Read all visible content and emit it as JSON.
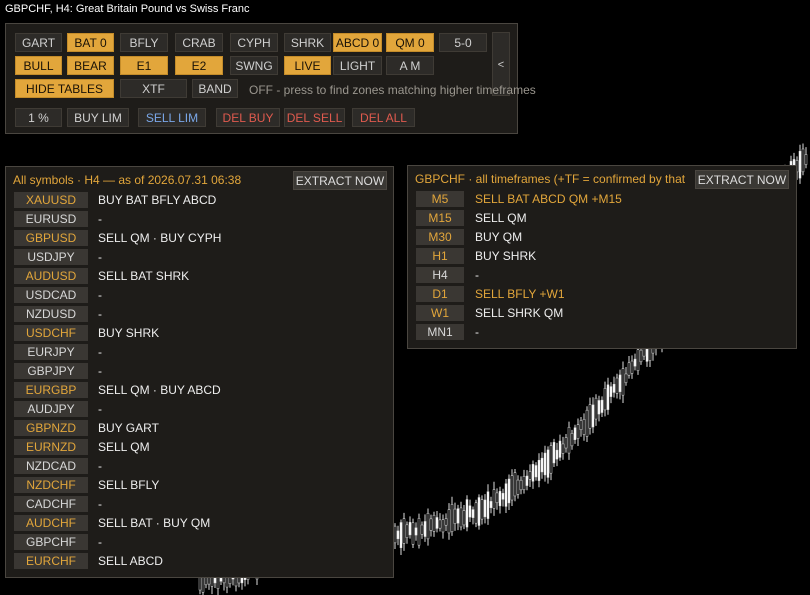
{
  "window": {
    "title": "GBPCHF, H4:  Great Britain Pound vs Swiss Franc"
  },
  "colors": {
    "accent": "#e2a63b",
    "button": "#2d2b28",
    "panel": "#1e1c19",
    "buy_lim": "#7aa7e8",
    "delete": "#e05a4e"
  },
  "toolbar": {
    "buttons": [
      {
        "label": "GART",
        "active": false
      },
      {
        "label": "BAT 0",
        "active": true
      },
      {
        "label": "BFLY",
        "active": false
      },
      {
        "label": "CRAB",
        "active": false
      },
      {
        "label": "CYPH",
        "active": false
      },
      {
        "label": "SHRK",
        "active": false
      },
      {
        "label": "ABCD 0",
        "active": true
      },
      {
        "label": "QM 0",
        "active": true
      },
      {
        "label": "5-0",
        "active": false
      },
      {
        "label": "BULL",
        "active": true
      },
      {
        "label": "BEAR",
        "active": true
      },
      {
        "label": "E1",
        "active": true
      },
      {
        "label": "E2",
        "active": true
      },
      {
        "label": "SWNG",
        "active": false
      },
      {
        "label": "LIVE",
        "active": true
      },
      {
        "label": "LIGHT",
        "active": false
      },
      {
        "label": "A M",
        "active": false
      },
      {
        "label": "HIDE TABLES",
        "active": true
      },
      {
        "label": "XTF",
        "active": false
      },
      {
        "label": "BAND",
        "active": false
      },
      {
        "label": "1 %",
        "active": false
      },
      {
        "label": "BUY LIM",
        "active": false
      },
      {
        "label": "SELL LIM",
        "active": false
      },
      {
        "label": "DEL BUY",
        "active": false
      },
      {
        "label": "DEL SELL",
        "active": false
      },
      {
        "label": "DEL ALL",
        "active": false
      }
    ],
    "collapse_label": "<",
    "hint": "OFF - press to find zones matching higher timeframes"
  },
  "symbols_panel": {
    "title": "All symbols · H4 — as of 2026.07.31 06:38",
    "extract_label": "EXTRACT NOW",
    "rows": [
      {
        "symbol": "XAUUSD",
        "signal": "BUY BAT BFLY ABCD",
        "highlight": true
      },
      {
        "symbol": "EURUSD",
        "signal": "-",
        "highlight": false
      },
      {
        "symbol": "GBPUSD",
        "signal": "SELL QM · BUY CYPH",
        "highlight": true
      },
      {
        "symbol": "USDJPY",
        "signal": "-",
        "highlight": false
      },
      {
        "symbol": "AUDUSD",
        "signal": "SELL BAT SHRK",
        "highlight": true
      },
      {
        "symbol": "USDCAD",
        "signal": "-",
        "highlight": false
      },
      {
        "symbol": "NZDUSD",
        "signal": "-",
        "highlight": false
      },
      {
        "symbol": "USDCHF",
        "signal": "BUY SHRK",
        "highlight": true
      },
      {
        "symbol": "EURJPY",
        "signal": "-",
        "highlight": false
      },
      {
        "symbol": "GBPJPY",
        "signal": "-",
        "highlight": false
      },
      {
        "symbol": "EURGBP",
        "signal": "SELL QM · BUY ABCD",
        "highlight": true
      },
      {
        "symbol": "AUDJPY",
        "signal": "-",
        "highlight": false
      },
      {
        "symbol": "GBPNZD",
        "signal": "BUY GART",
        "highlight": true
      },
      {
        "symbol": "EURNZD",
        "signal": "SELL QM",
        "highlight": true
      },
      {
        "symbol": "NZDCAD",
        "signal": "-",
        "highlight": false
      },
      {
        "symbol": "NZDCHF",
        "signal": "SELL BFLY",
        "highlight": true
      },
      {
        "symbol": "CADCHF",
        "signal": "-",
        "highlight": false
      },
      {
        "symbol": "AUDCHF",
        "signal": "SELL BAT · BUY QM",
        "highlight": true
      },
      {
        "symbol": "GBPCHF",
        "signal": "-",
        "highlight": false
      },
      {
        "symbol": "EURCHF",
        "signal": "SELL ABCD",
        "highlight": true
      }
    ]
  },
  "timeframes_panel": {
    "title": "GBPCHF · all timeframes  (+TF = confirmed by that",
    "extract_label": "EXTRACT NOW",
    "rows": [
      {
        "tf": "M5",
        "signal": "SELL BAT ABCD QM   +M15",
        "highlight": true,
        "signal_highlight": true
      },
      {
        "tf": "M15",
        "signal": "SELL QM",
        "highlight": true,
        "signal_highlight": false
      },
      {
        "tf": "M30",
        "signal": "BUY QM",
        "highlight": true,
        "signal_highlight": false
      },
      {
        "tf": "H1",
        "signal": "BUY SHRK",
        "highlight": true,
        "signal_highlight": false
      },
      {
        "tf": "H4",
        "signal": "-",
        "highlight": false,
        "signal_highlight": false
      },
      {
        "tf": "D1",
        "signal": "SELL BFLY   +W1",
        "highlight": true,
        "signal_highlight": true
      },
      {
        "tf": "W1",
        "signal": "SELL SHRK QM",
        "highlight": true,
        "signal_highlight": false
      },
      {
        "tf": "MN1",
        "signal": "-",
        "highlight": false,
        "signal_highlight": false
      }
    ]
  }
}
